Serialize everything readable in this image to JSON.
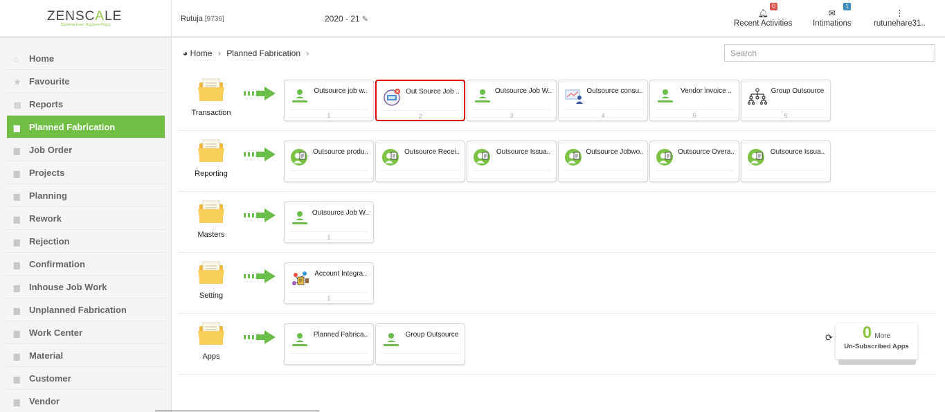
{
  "header": {
    "logo_prefix": "ZENSC",
    "logo_accent": "A",
    "logo_suffix": "LE",
    "logo_tagline": "Business Ease. Business Peace.",
    "user_name": "Rutuja",
    "user_id": "[9736]",
    "year": "2020 - 21",
    "recent_activities_label": "Recent Activities",
    "recent_activities_count": "0",
    "intimations_label": "Intimations",
    "intimations_count": "1",
    "account_label": "rutunehare31.."
  },
  "sidebar": {
    "items": [
      {
        "label": "Home",
        "icon": "home-icon"
      },
      {
        "label": "Favourite",
        "icon": "star-icon"
      },
      {
        "label": "Reports",
        "icon": "document-icon"
      },
      {
        "label": "Planned Fabrication",
        "icon": "folder-icon",
        "active": true
      },
      {
        "label": "Job Order",
        "icon": "folder-icon"
      },
      {
        "label": "Projects",
        "icon": "folder-icon"
      },
      {
        "label": "Planning",
        "icon": "folder-icon"
      },
      {
        "label": "Rework",
        "icon": "folder-icon"
      },
      {
        "label": "Rejection",
        "icon": "folder-icon"
      },
      {
        "label": "Confirmation",
        "icon": "folder-icon"
      },
      {
        "label": "Inhouse Job Work",
        "icon": "folder-icon"
      },
      {
        "label": "Unplanned Fabrication",
        "icon": "folder-icon"
      },
      {
        "label": "Work Center",
        "icon": "folder-icon"
      },
      {
        "label": "Material",
        "icon": "folder-icon"
      },
      {
        "label": "Customer",
        "icon": "folder-icon"
      },
      {
        "label": "Vendor",
        "icon": "folder-icon"
      }
    ]
  },
  "breadcrumb": {
    "home": "Home",
    "current": "Planned Fabrication"
  },
  "search": {
    "placeholder": "Search"
  },
  "sections": [
    {
      "label": "Transaction",
      "cards": [
        {
          "title": "Outsource job w..",
          "num": "1",
          "icon": "user-icon"
        },
        {
          "title": "Out Source Job ..",
          "num": "2",
          "icon": "ticket-icon"
        },
        {
          "title": "Outsource Job W..",
          "num": "3",
          "icon": "user-icon"
        },
        {
          "title": "Outsource consu..",
          "num": "4",
          "icon": "consultant-icon"
        },
        {
          "title": "Vendor invoice ..",
          "num": "5",
          "icon": "user-icon"
        },
        {
          "title": "Group Outsource",
          "num": "6",
          "icon": "hierarchy-icon"
        }
      ]
    },
    {
      "label": "Reporting",
      "cards": [
        {
          "title": "Outsource produ..",
          "num": "",
          "icon": "report-person-icon"
        },
        {
          "title": "Outsource Recei..",
          "num": "",
          "icon": "report-person-icon"
        },
        {
          "title": "Outsource Issua..",
          "num": "",
          "icon": "report-person-icon"
        },
        {
          "title": "Outsource Jobwo..",
          "num": "",
          "icon": "report-person-icon"
        },
        {
          "title": "Outsource Overa..",
          "num": "",
          "icon": "report-person-icon"
        },
        {
          "title": "Outsource Issua..",
          "num": "",
          "icon": "report-person-icon"
        }
      ]
    },
    {
      "label": "Masters",
      "cards": [
        {
          "title": "Outsource Job W..",
          "num": "1",
          "icon": "user-icon"
        }
      ]
    },
    {
      "label": "Setting",
      "cards": [
        {
          "title": "Account Integra..",
          "num": "1",
          "icon": "integration-icon"
        }
      ]
    },
    {
      "label": "Apps",
      "cards": [
        {
          "title": "Planned Fabrica..",
          "num": "",
          "icon": "user-icon"
        },
        {
          "title": "Group Outsource",
          "num": "",
          "icon": "user-icon"
        }
      ]
    }
  ],
  "more_apps": {
    "count": "0",
    "more_label": "More",
    "sub_label": "Un-Subscribed Apps"
  }
}
